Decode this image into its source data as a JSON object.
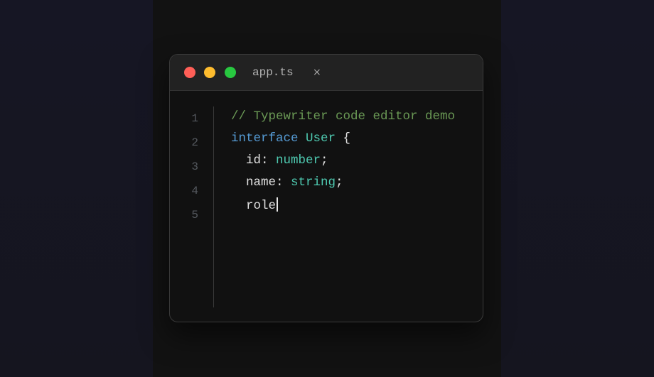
{
  "window": {
    "tab_name": "app.ts",
    "close_glyph": "×",
    "traffic_lights": {
      "close": "#ff5f57",
      "minimize": "#febc2e",
      "maximize": "#28c840"
    }
  },
  "editor": {
    "line_numbers": [
      "1",
      "2",
      "3",
      "4",
      "5"
    ],
    "lines": [
      [
        {
          "text": "// Typewriter code editor demo",
          "color": "#6a9955"
        }
      ],
      [
        {
          "text": "interface ",
          "color": "#569cd6"
        },
        {
          "text": "User",
          "color": "#4ec9b0"
        },
        {
          "text": " {",
          "color": "#e2e2e2"
        }
      ],
      [
        {
          "text": "  id: ",
          "color": "#e2e2e2"
        },
        {
          "text": "number",
          "color": "#4ec9b0"
        },
        {
          "text": ";",
          "color": "#e2e2e2"
        }
      ],
      [
        {
          "text": "  name: ",
          "color": "#e2e2e2"
        },
        {
          "text": "string",
          "color": "#4ec9b0"
        },
        {
          "text": ";",
          "color": "#e2e2e2"
        }
      ],
      [
        {
          "text": "  role",
          "color": "#e2e2e2"
        }
      ]
    ],
    "cursor_line": 5
  }
}
